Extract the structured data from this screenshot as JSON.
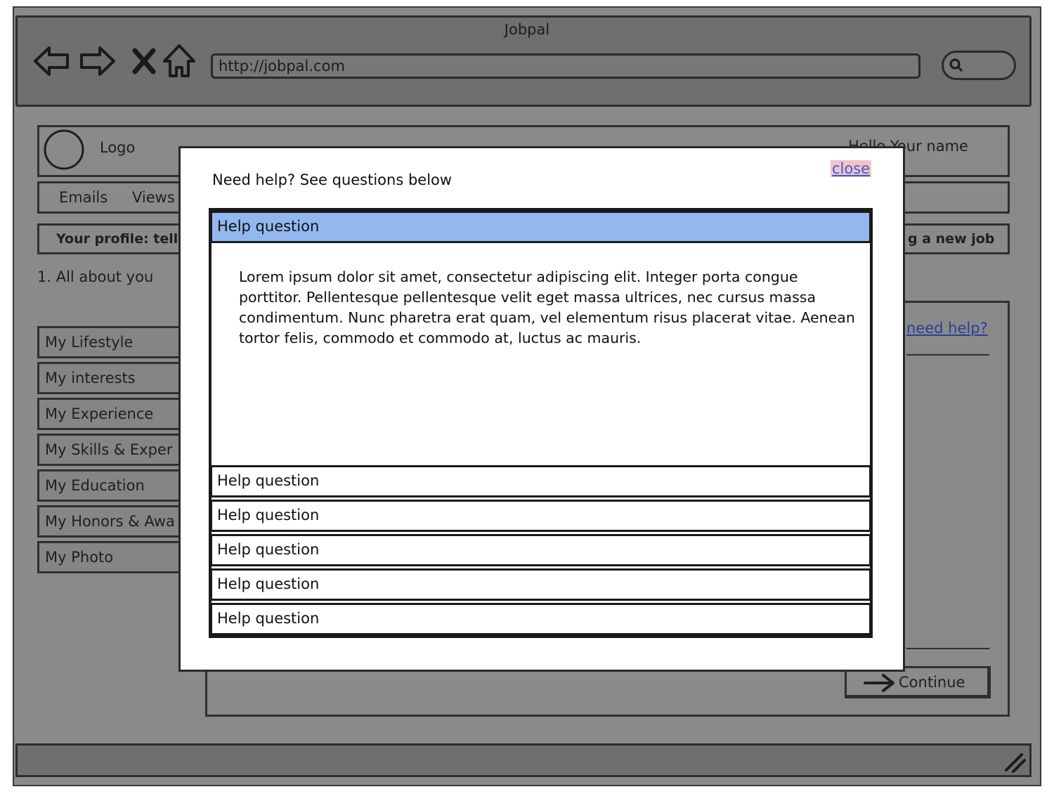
{
  "window": {
    "title": "Jobpal"
  },
  "browser": {
    "url": "http://jobpal.com",
    "icons": [
      "back-arrow-icon",
      "forward-arrow-icon",
      "stop-x-icon",
      "home-icon",
      "search-icon"
    ]
  },
  "background_page": {
    "logo_label": "Logo",
    "greeting": "Hello Your name",
    "nav": [
      "Emails",
      "Views"
    ],
    "banner_left": "Your profile: tell",
    "banner_right": "g a new job",
    "step_label": "1. All about you",
    "sidebar": [
      "My Lifestyle",
      "My interests",
      "My Experience",
      "My Skills & Exper",
      "My Education",
      "My Honors & Awa",
      "My Photo"
    ],
    "help_link": "need help?",
    "continue_label": "Continue"
  },
  "modal": {
    "heading": "Need help? See questions below",
    "close_label": "close",
    "questions": [
      {
        "label": "Help question",
        "expanded": true,
        "answer": "Lorem ipsum dolor sit amet, consectetur adipiscing elit. Integer porta congue porttitor. Pellentesque pellentesque velit eget massa ultrices, nec cursus massa condimentum. Nunc pharetra erat quam, vel elementum risus placerat vitae. Aenean tortor felis, commodo et commodo at, luctus ac mauris."
      },
      {
        "label": "Help question",
        "expanded": false
      },
      {
        "label": "Help question",
        "expanded": false
      },
      {
        "label": "Help question",
        "expanded": false
      },
      {
        "label": "Help question",
        "expanded": false
      },
      {
        "label": "Help question",
        "expanded": false
      }
    ]
  },
  "colors": {
    "overlay_gray": "#8a8a8a",
    "active_question": "#93b8ef",
    "close_highlight": "#f3c4c4",
    "link_blue": "#3a5bd9"
  }
}
